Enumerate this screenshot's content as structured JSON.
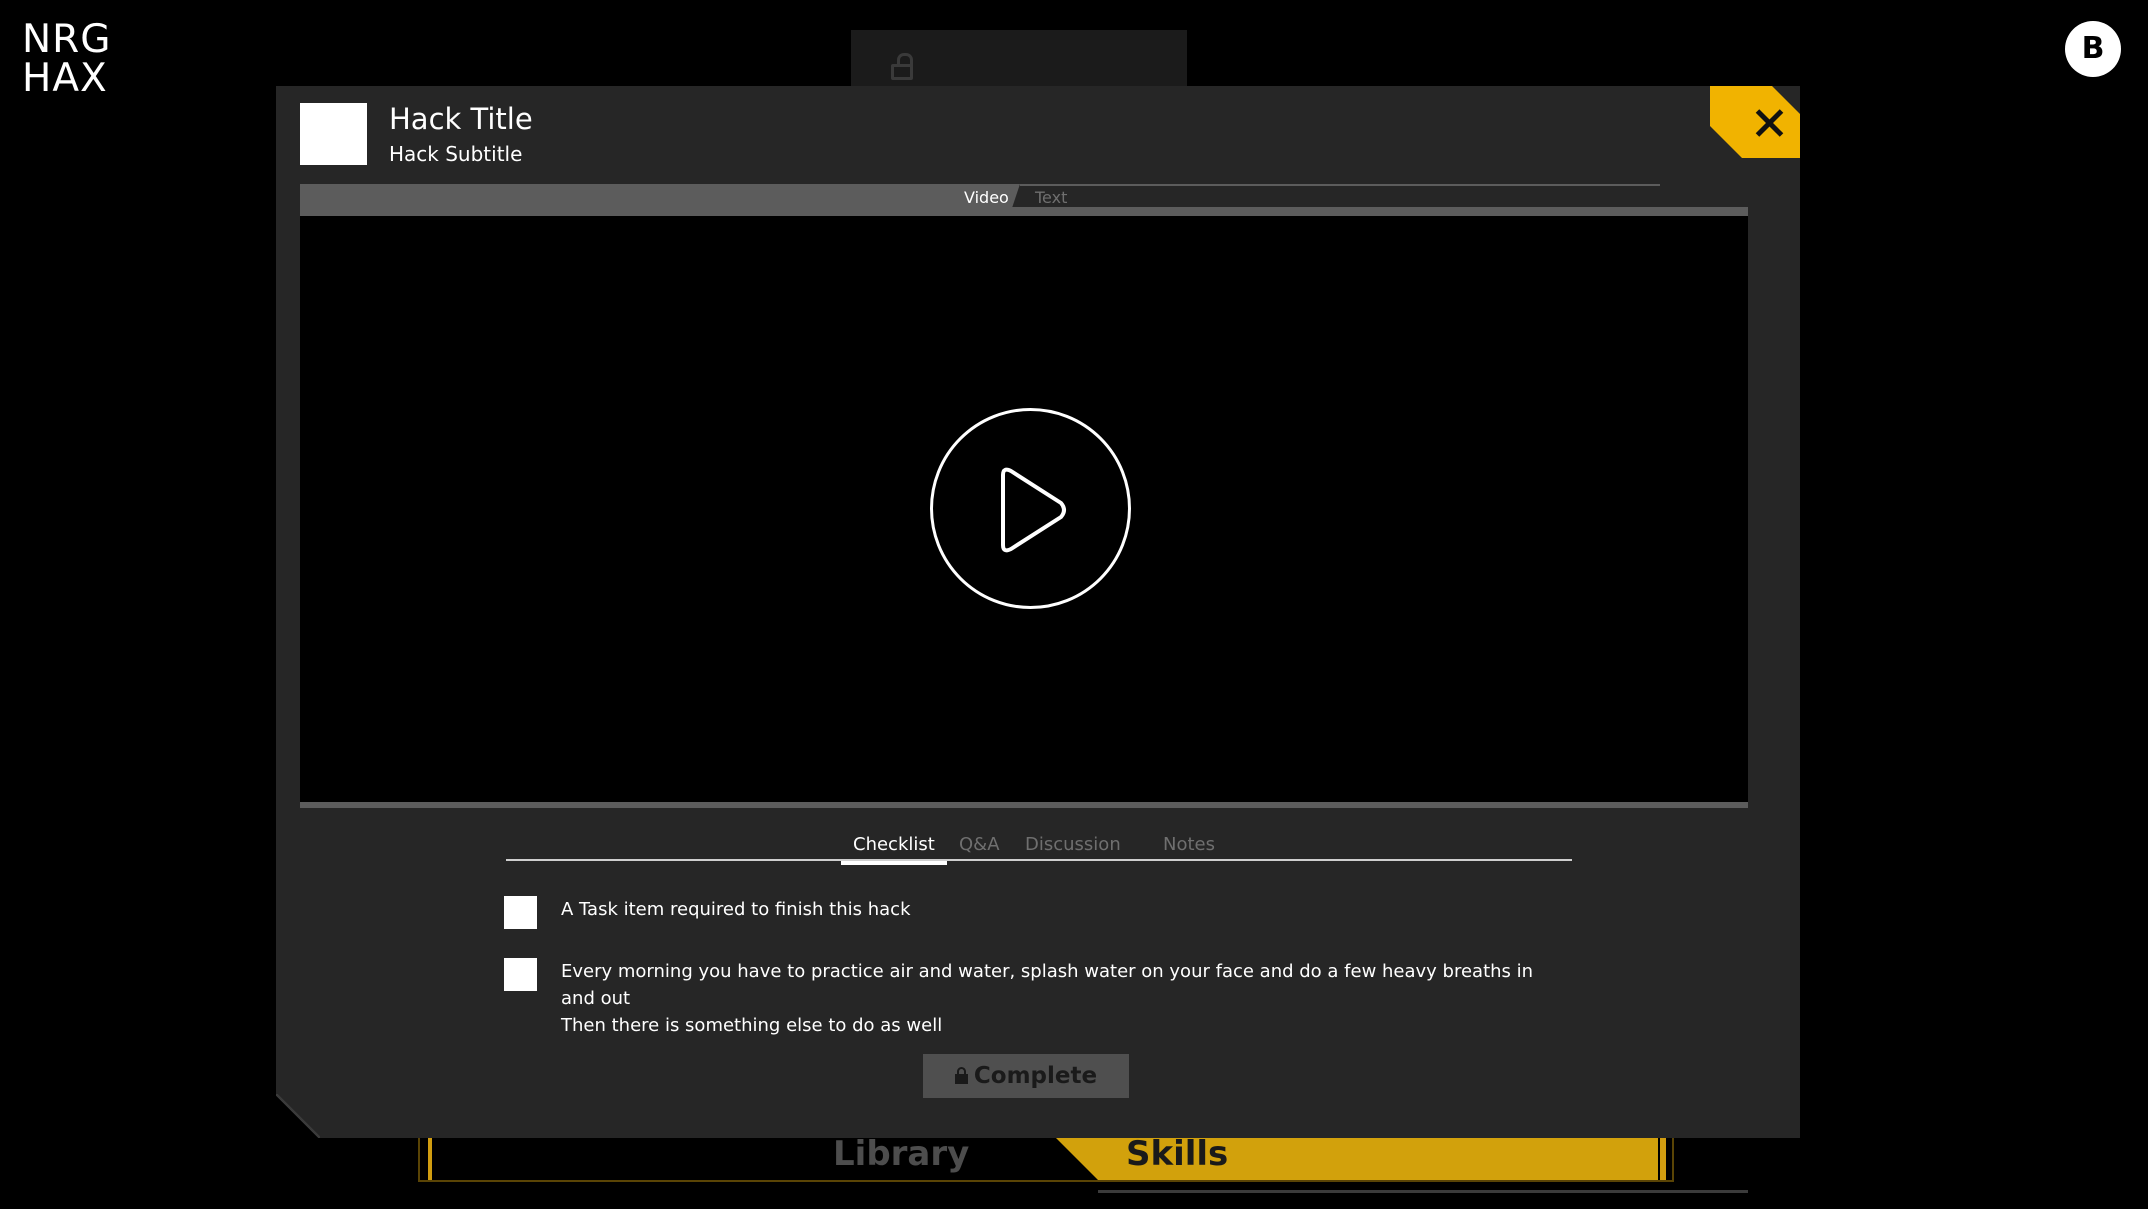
{
  "brand": {
    "line1": "NRG",
    "line2": "HAX"
  },
  "user": {
    "avatar_initial": "B"
  },
  "bottom_nav": {
    "library_label": "Library",
    "skills_label": "Skills"
  },
  "modal": {
    "title": "Hack Title",
    "subtitle": "Hack Subtitle",
    "media_tabs": [
      {
        "label": "Video",
        "active": true
      },
      {
        "label": "Text",
        "active": false
      }
    ],
    "content_tabs": [
      {
        "label": "Checklist",
        "active": true
      },
      {
        "label": "Q&A",
        "active": false
      },
      {
        "label": "Discussion",
        "active": false
      },
      {
        "label": "Notes",
        "active": false
      }
    ],
    "checklist": [
      {
        "text": "A Task item required to finish this hack",
        "checked": false
      },
      {
        "text": "Every morning you have to practice air and water, splash water on your face and do a few heavy breaths in and out\nThen there is something else to do as well",
        "checked": false
      }
    ],
    "complete_label": "Complete"
  },
  "colors": {
    "accent": "#f1b300",
    "modal_bg": "#262626",
    "tab_bar": "#5c5c5c",
    "inactive_text": "#6f6f6f"
  },
  "icons": {
    "close": "close-icon",
    "play": "play-icon",
    "lock": "lock-icon"
  }
}
